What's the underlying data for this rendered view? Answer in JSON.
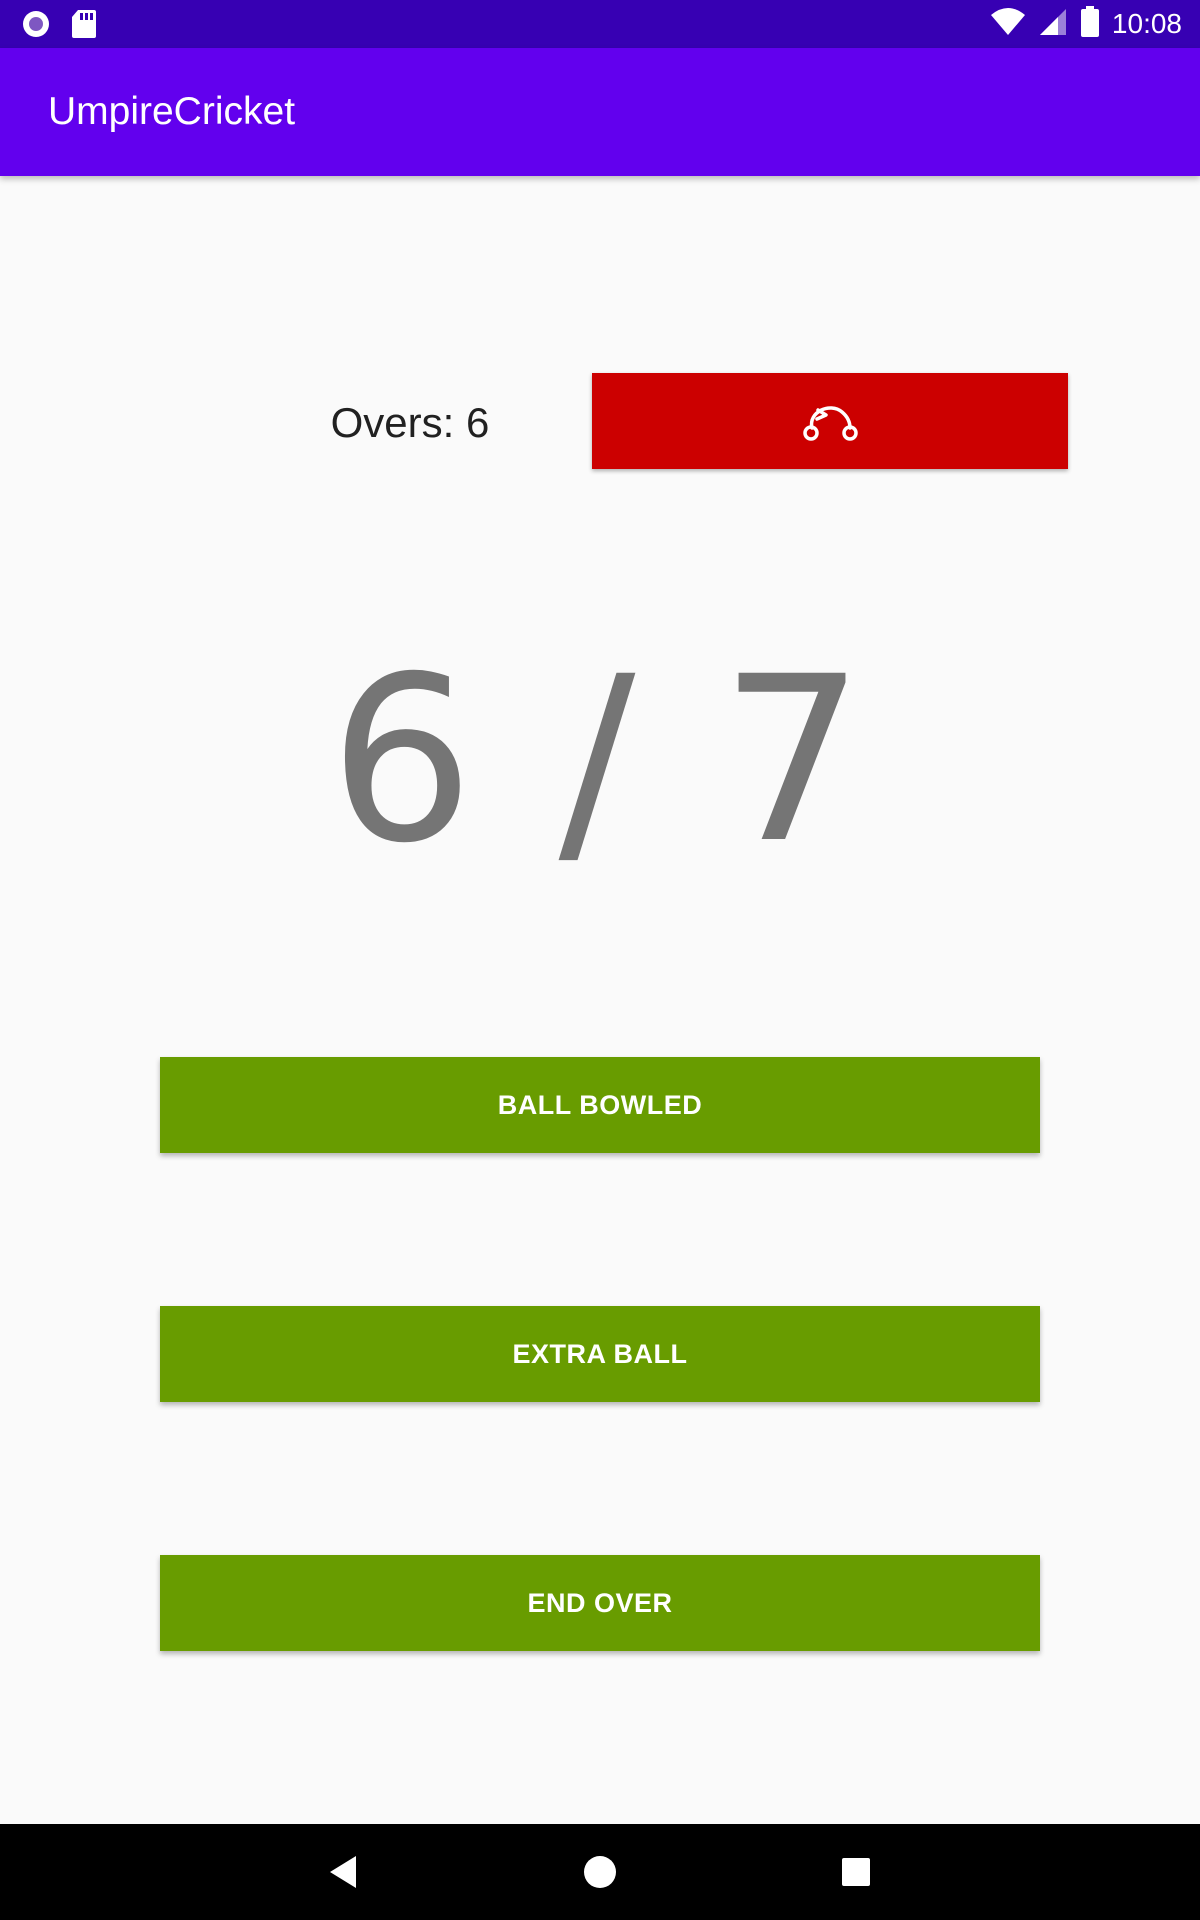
{
  "status_bar": {
    "time": "10:08",
    "icons": [
      "radio-icon",
      "sd-card-icon",
      "wifi-icon",
      "signal-icon",
      "battery-icon"
    ]
  },
  "app_bar": {
    "title": "UmpireCricket",
    "color": "#6200ee"
  },
  "main": {
    "overs_label": "Overs: 6",
    "reset_button_icon": "reset-icon",
    "reset_button_color": "#cc0000",
    "ball_counter": "6 / 7",
    "buttons": {
      "ball_bowled": "BALL BOWLED",
      "extra_ball": "EXTRA BALL",
      "end_over": "END OVER"
    },
    "button_color": "#689c00"
  },
  "nav_bar": {
    "icons": [
      "back-icon",
      "home-icon",
      "recents-icon"
    ]
  }
}
